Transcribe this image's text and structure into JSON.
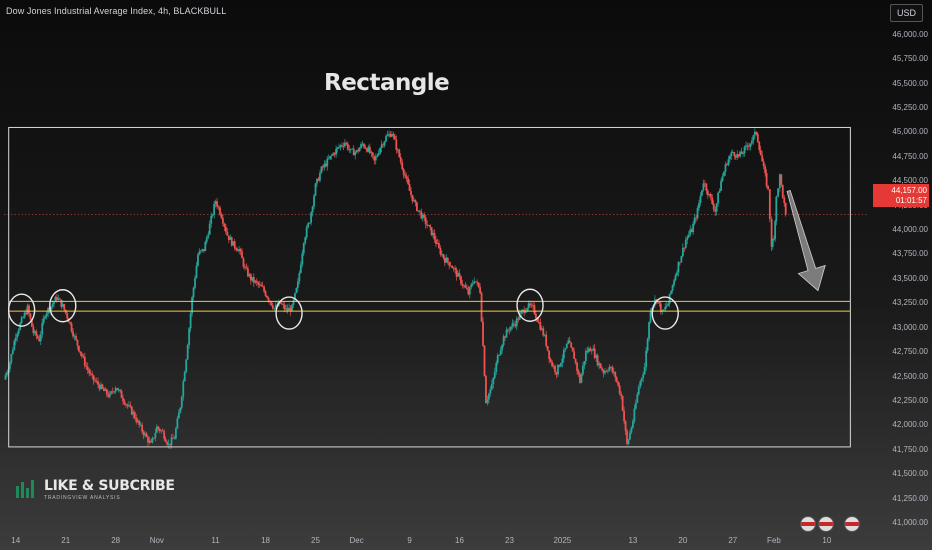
{
  "header": {
    "ticker": "Dow Jones Industrial Average Index, 4h, BLACKBULL",
    "currency": "USD"
  },
  "annotation": {
    "title": "Rectangle"
  },
  "watermark": {
    "main": "LIKE & SUBCRIBE",
    "sub": "TRADINGVIEW ANALYSIS"
  },
  "current_price": {
    "value": "44,157.00",
    "countdown": "01:01:57"
  },
  "colors": {
    "up": "#26a69a",
    "down": "#ef5350",
    "zone": "#f5c542",
    "box": "#d8d8d8",
    "arrow": "#9e9e9e",
    "price_line": "#ef5350"
  },
  "icons": [
    "economic-event-flag-icon",
    "economic-event-flag-icon",
    "economic-event-flag-icon"
  ],
  "chart_data": {
    "type": "candlestick",
    "title": "",
    "y_axis_labels": [
      "46,000.00",
      "45,750.00",
      "45,500.00",
      "45,250.00",
      "45,000.00",
      "44,750.00",
      "44,500.00",
      "44,250.00",
      "44,000.00",
      "43,750.00",
      "43,500.00",
      "43,250.00",
      "43,000.00",
      "42,750.00",
      "42,500.00",
      "42,250.00",
      "42,000.00",
      "41,750.00",
      "41,500.00",
      "41,250.00",
      "41,000.00"
    ],
    "x_axis_labels": [
      "14",
      "21",
      "28",
      "Nov",
      "11",
      "18",
      "25",
      "Dec",
      "9",
      "16",
      "23",
      "2025",
      "13",
      "20",
      "27",
      "Feb",
      "10"
    ],
    "ylim": [
      40950,
      46150
    ],
    "x_range": [
      0,
      130
    ],
    "x_ticks": [
      2,
      10.5,
      19,
      26,
      36,
      44.5,
      53,
      60,
      69,
      77.5,
      86,
      95,
      107,
      115.5,
      124,
      131,
      140
    ],
    "rectangle": {
      "x_start": 0.8,
      "x_end": 144,
      "y_low": 41780,
      "y_high": 45050
    },
    "support_zone": {
      "y_low": 43170,
      "y_high": 43270
    },
    "touch_circles": [
      {
        "x": 3,
        "y": 43180
      },
      {
        "x": 10,
        "y": 43225
      },
      {
        "x": 48.5,
        "y": 43150
      },
      {
        "x": 89.5,
        "y": 43230
      },
      {
        "x": 112.5,
        "y": 43150
      }
    ],
    "projection": {
      "from": {
        "x": 133.5,
        "y": 44400
      },
      "to": {
        "x": 138.5,
        "y": 43380
      }
    },
    "price_line": 44157,
    "anchors": [
      [
        0,
        42470
      ],
      [
        1,
        42650
      ],
      [
        2,
        42930
      ],
      [
        3,
        43070
      ],
      [
        4,
        43200
      ],
      [
        5,
        42950
      ],
      [
        6,
        42880
      ],
      [
        7,
        43150
      ],
      [
        8,
        43220
      ],
      [
        9,
        43310
      ],
      [
        10,
        43220
      ],
      [
        11,
        43080
      ],
      [
        12,
        42900
      ],
      [
        13,
        42750
      ],
      [
        14,
        42600
      ],
      [
        15,
        42480
      ],
      [
        16,
        42420
      ],
      [
        17,
        42350
      ],
      [
        18,
        42300
      ],
      [
        19,
        42400
      ],
      [
        20,
        42300
      ],
      [
        21,
        42200
      ],
      [
        22,
        42120
      ],
      [
        23,
        42000
      ],
      [
        24,
        41900
      ],
      [
        25,
        41800
      ],
      [
        26,
        41980
      ],
      [
        27,
        41930
      ],
      [
        28,
        41800
      ],
      [
        29,
        41880
      ],
      [
        30,
        42200
      ],
      [
        31,
        42700
      ],
      [
        32,
        43300
      ],
      [
        33,
        43750
      ],
      [
        34,
        43800
      ],
      [
        35,
        44050
      ],
      [
        36,
        44300
      ],
      [
        37,
        44150
      ],
      [
        38,
        43950
      ],
      [
        39,
        43850
      ],
      [
        40,
        43800
      ],
      [
        41,
        43600
      ],
      [
        42,
        43500
      ],
      [
        43,
        43450
      ],
      [
        44,
        43400
      ],
      [
        45,
        43300
      ],
      [
        46,
        43200
      ],
      [
        47,
        43250
      ],
      [
        48,
        43180
      ],
      [
        49,
        43200
      ],
      [
        50,
        43450
      ],
      [
        51,
        43900
      ],
      [
        52,
        44100
      ],
      [
        53,
        44450
      ],
      [
        54,
        44620
      ],
      [
        55,
        44700
      ],
      [
        56,
        44780
      ],
      [
        57,
        44850
      ],
      [
        58,
        44900
      ],
      [
        59,
        44800
      ],
      [
        60,
        44800
      ],
      [
        61,
        44880
      ],
      [
        62,
        44820
      ],
      [
        63,
        44700
      ],
      [
        64,
        44850
      ],
      [
        65,
        44950
      ],
      [
        66,
        45000
      ],
      [
        67,
        44800
      ],
      [
        68,
        44600
      ],
      [
        69,
        44400
      ],
      [
        70,
        44250
      ],
      [
        71,
        44150
      ],
      [
        72,
        44050
      ],
      [
        73,
        43950
      ],
      [
        74,
        43800
      ],
      [
        75,
        43700
      ],
      [
        76,
        43650
      ],
      [
        77,
        43550
      ],
      [
        78,
        43450
      ],
      [
        79,
        43350
      ],
      [
        80,
        43500
      ],
      [
        81,
        43380
      ],
      [
        82,
        42250
      ],
      [
        83,
        42400
      ],
      [
        84,
        42700
      ],
      [
        85,
        42900
      ],
      [
        86,
        43000
      ],
      [
        87,
        43050
      ],
      [
        88,
        43150
      ],
      [
        89,
        43220
      ],
      [
        90,
        43200
      ],
      [
        91,
        43050
      ],
      [
        92,
        42900
      ],
      [
        93,
        42650
      ],
      [
        94,
        42550
      ],
      [
        95,
        42700
      ],
      [
        96,
        42850
      ],
      [
        97,
        42700
      ],
      [
        98,
        42450
      ],
      [
        99,
        42750
      ],
      [
        100,
        42800
      ],
      [
        101,
        42650
      ],
      [
        102,
        42550
      ],
      [
        103,
        42600
      ],
      [
        104,
        42500
      ],
      [
        105,
        42300
      ],
      [
        106,
        41800
      ],
      [
        107,
        42050
      ],
      [
        108,
        42400
      ],
      [
        109,
        42600
      ],
      [
        110,
        43200
      ],
      [
        111,
        43300
      ],
      [
        112,
        43150
      ],
      [
        113,
        43250
      ],
      [
        114,
        43500
      ],
      [
        115,
        43700
      ],
      [
        116,
        43900
      ],
      [
        117,
        44000
      ],
      [
        118,
        44200
      ],
      [
        119,
        44500
      ],
      [
        120,
        44350
      ],
      [
        121,
        44200
      ],
      [
        122,
        44500
      ],
      [
        123,
        44700
      ],
      [
        124,
        44800
      ],
      [
        125,
        44750
      ],
      [
        126,
        44820
      ],
      [
        127,
        44900
      ],
      [
        128,
        45000
      ],
      [
        129,
        44700
      ],
      [
        130,
        44400
      ],
      [
        130.6,
        43850
      ],
      [
        131,
        43900
      ],
      [
        131.4,
        44350
      ],
      [
        132,
        44550
      ],
      [
        133,
        44157
      ]
    ]
  }
}
